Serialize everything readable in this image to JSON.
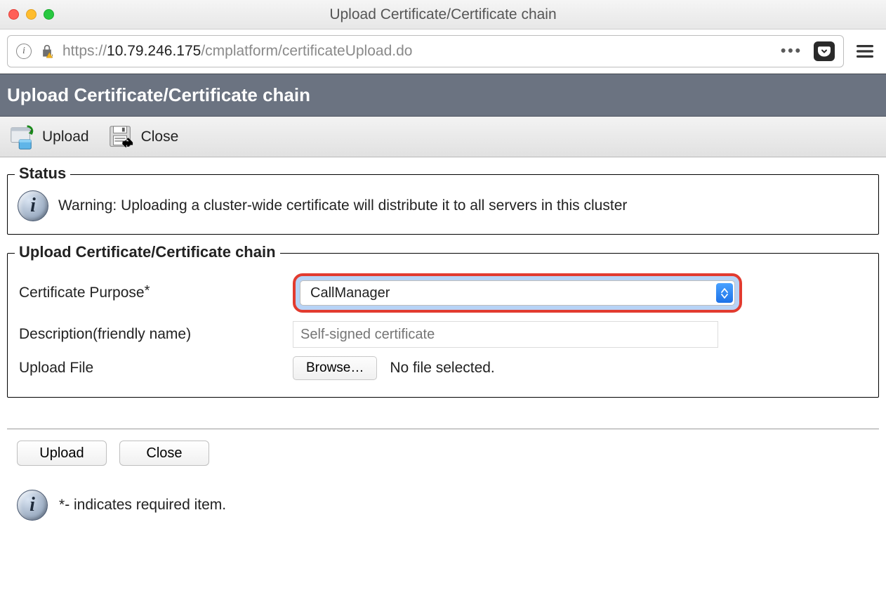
{
  "window": {
    "title": "Upload Certificate/Certificate chain"
  },
  "url": {
    "scheme": "https://",
    "host": "10.79.246.175",
    "path": "/cmplatform/certificateUpload.do"
  },
  "header": {
    "title": "Upload Certificate/Certificate chain"
  },
  "toolbar": {
    "upload_label": "Upload",
    "close_label": "Close"
  },
  "status": {
    "legend": "Status",
    "message": "Warning: Uploading a cluster-wide certificate will distribute it to all servers in this cluster"
  },
  "form": {
    "legend": "Upload Certificate/Certificate chain",
    "purpose_label": "Certificate Purpose",
    "purpose_value": "CallManager",
    "description_label": "Description(friendly name)",
    "description_placeholder": "Self-signed certificate",
    "upload_file_label": "Upload File",
    "browse_label": "Browse…",
    "no_file_text": "No file selected."
  },
  "buttons": {
    "upload": "Upload",
    "close": "Close"
  },
  "footer": {
    "note_prefix": "*",
    "note_text": "- indicates required item."
  }
}
